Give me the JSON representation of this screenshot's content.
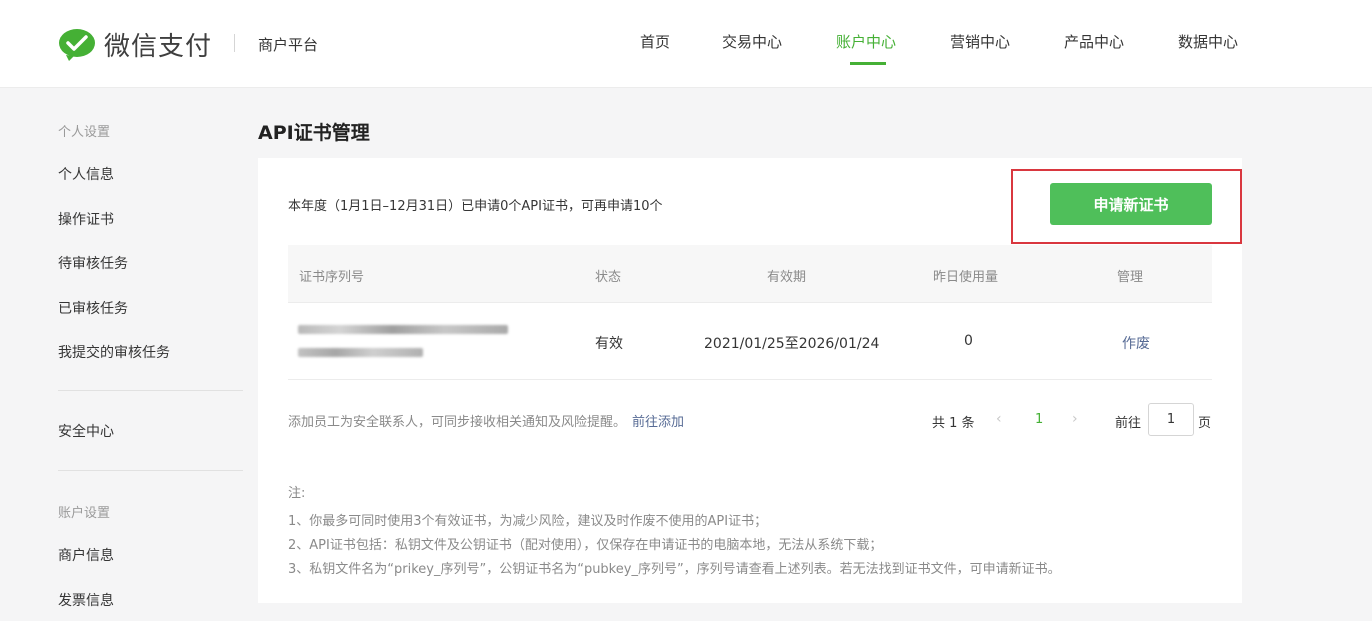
{
  "brand": {
    "name": "微信支付",
    "platform": "商户平台",
    "brand_color": "#45b035"
  },
  "nav": {
    "items": [
      {
        "label": "首页",
        "active": false
      },
      {
        "label": "交易中心",
        "active": false
      },
      {
        "label": "账户中心",
        "active": true
      },
      {
        "label": "营销中心",
        "active": false
      },
      {
        "label": "产品中心",
        "active": false
      },
      {
        "label": "数据中心",
        "active": false
      }
    ]
  },
  "sidebar": {
    "group1": "个人设置",
    "items1": [
      "个人信息",
      "操作证书",
      "待审核任务",
      "已审核任务",
      "我提交的审核任务"
    ],
    "security": "安全中心",
    "group2": "账户设置",
    "items2": [
      "商户信息",
      "发票信息"
    ]
  },
  "page": {
    "title": "API证书管理"
  },
  "card": {
    "summary": "本年度（1月1日–12月31日）已申请0个API证书，可再申请10个",
    "apply_button": "申请新证书",
    "table": {
      "headers": [
        "证书序列号",
        "状态",
        "有效期",
        "昨日使用量",
        "管理"
      ],
      "rows": [
        {
          "serial": "",
          "status": "有效",
          "validity": "2021/01/25至2026/01/24",
          "usage": "0",
          "action": "作废"
        }
      ]
    },
    "notice": {
      "text": "添加员工为安全联系人，可同步接收相关通知及风险提醒。",
      "link": "前往添加"
    },
    "pagination": {
      "total": "共 1 条",
      "prev_icon": "chevron-left-icon",
      "current": "1",
      "next_icon": "chevron-right-icon",
      "goto_label": "前往",
      "page_value": "1",
      "page_unit": "页"
    },
    "notes": {
      "title": "注:",
      "lines": [
        "1、你最多可同时使用3个有效证书，为减少风险，建议及时作废不使用的API证书；",
        "2、API证书包括：私钥文件及公钥证书（配对使用），仅保存在申请证书的电脑本地，无法从系统下载；",
        "3、私钥文件名为“prikey_序列号”，公钥证书名为“pubkey_序列号”，序列号请查看上述列表。若无法找到证书文件，可申请新证书。"
      ]
    }
  },
  "colors": {
    "accent": "#45b035",
    "button": "#4fbf5a",
    "link": "#576b95",
    "highlight_border": "#d9373f"
  }
}
